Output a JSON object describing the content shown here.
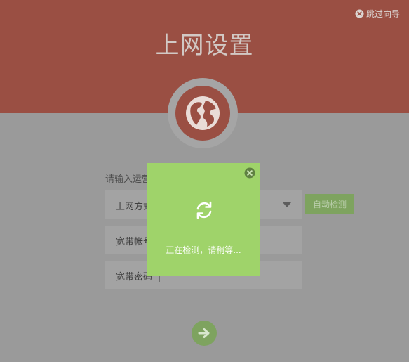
{
  "header": {
    "title": "上网设置",
    "skip_label": "跳过向导",
    "color": "#9a4f43"
  },
  "form": {
    "hint": "请输入运营",
    "fields": [
      {
        "label": "上网方式",
        "type": "select"
      },
      {
        "label": "宽带帐号",
        "type": "text"
      },
      {
        "label": "宽带密码",
        "type": "password"
      }
    ],
    "auto_detect_label": "自动检测"
  },
  "modal": {
    "message": "正在检测，请稍等...",
    "color": "#9fd36a"
  },
  "icons": {
    "skip": "close-circle-icon",
    "globe": "globe-icon",
    "spinner": "refresh-icon",
    "next": "arrow-right-icon",
    "modal_close": "close-circle-icon"
  }
}
